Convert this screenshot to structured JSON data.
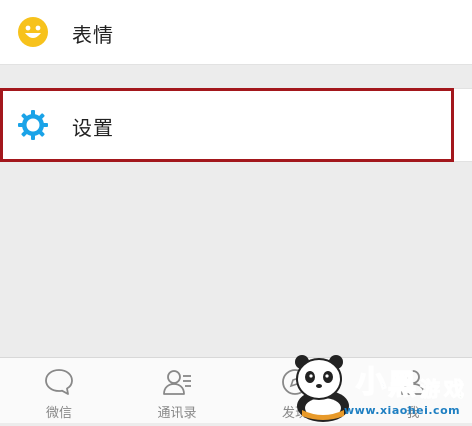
{
  "menu": {
    "emoji_label": "表情",
    "settings_label": "设置"
  },
  "tabs": [
    {
      "label": "微信",
      "icon": "chat-bubble-icon"
    },
    {
      "label": "通讯录",
      "icon": "contacts-icon"
    },
    {
      "label": "发现",
      "icon": "compass-icon"
    },
    {
      "label": "我",
      "icon": "person-icon"
    }
  ],
  "colors": {
    "highlight": "#a3171c",
    "emoji_yellow": "#f7c21c",
    "settings_blue": "#1aa3e8",
    "tab_gray": "#888888"
  },
  "watermark": {
    "logo_text": "小黑游戏",
    "url": "www.xiaohei.com"
  }
}
